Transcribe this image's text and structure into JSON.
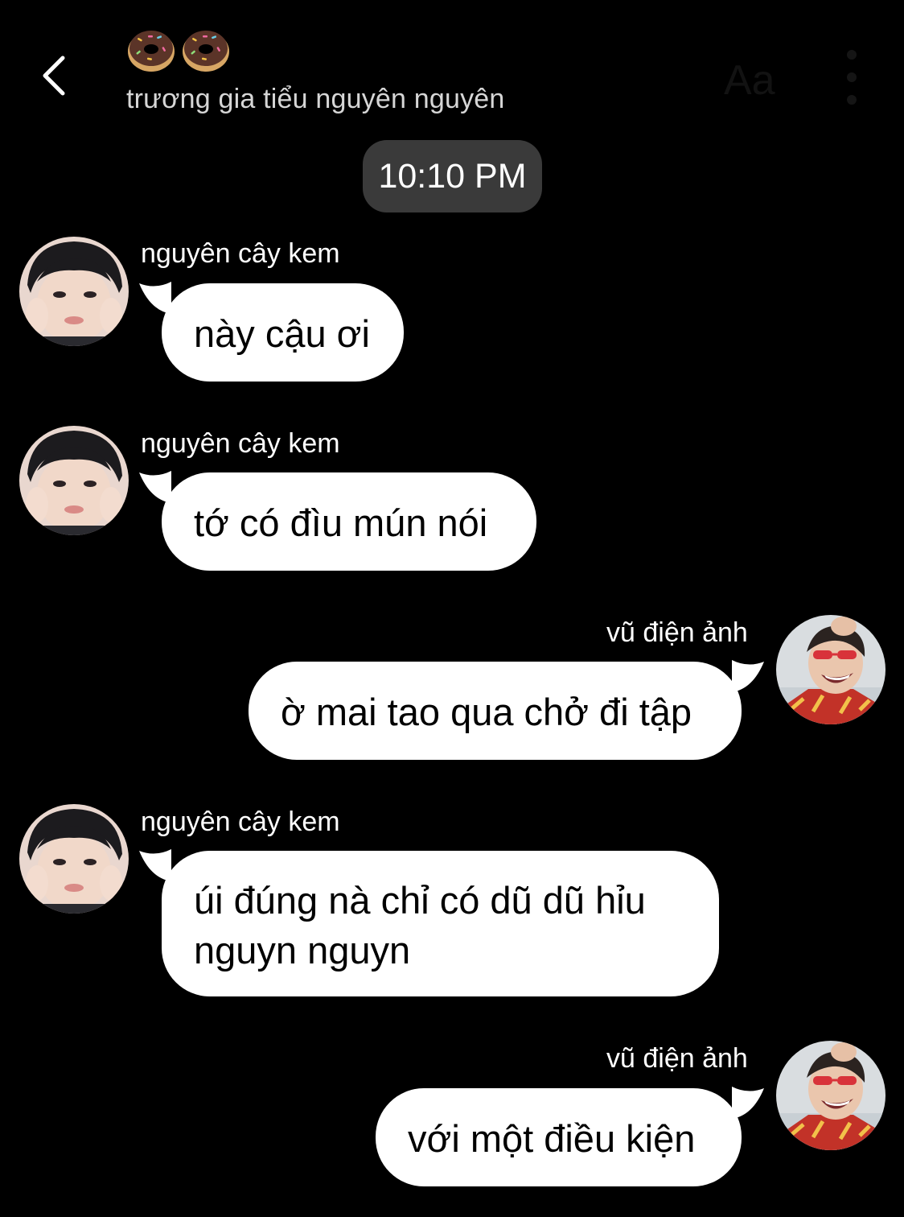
{
  "header": {
    "emoji": [
      "donut-emoji",
      "donut-emoji"
    ],
    "title": "trương gia tiểu nguyên nguyên",
    "font_button": "Aa",
    "back_icon": "chevron-left-icon",
    "more_icon": "vertical-ellipsis-icon"
  },
  "timestamp": "10:10 PM",
  "messages": [
    {
      "sender": "nguyên cây kem",
      "side": "left",
      "text": "này cậu ơi"
    },
    {
      "sender": "nguyên cây kem",
      "side": "left",
      "text": "tớ có đìu mún nói"
    },
    {
      "sender": "vũ điện ảnh",
      "side": "right",
      "text": "ờ mai tao qua chở đi tập"
    },
    {
      "sender": "nguyên cây kem",
      "side": "left",
      "text_lines": [
        "úi đúng nà chỉ có dũ dũ hỉu",
        "nguyn nguyn"
      ]
    },
    {
      "sender": "vũ điện ảnh",
      "side": "right",
      "text": "với một điều kiện"
    }
  ],
  "colors": {
    "background": "#000000",
    "bubble": "#ffffff",
    "time_pill": "#3a3a3a",
    "title_text": "#d6d6d6"
  }
}
